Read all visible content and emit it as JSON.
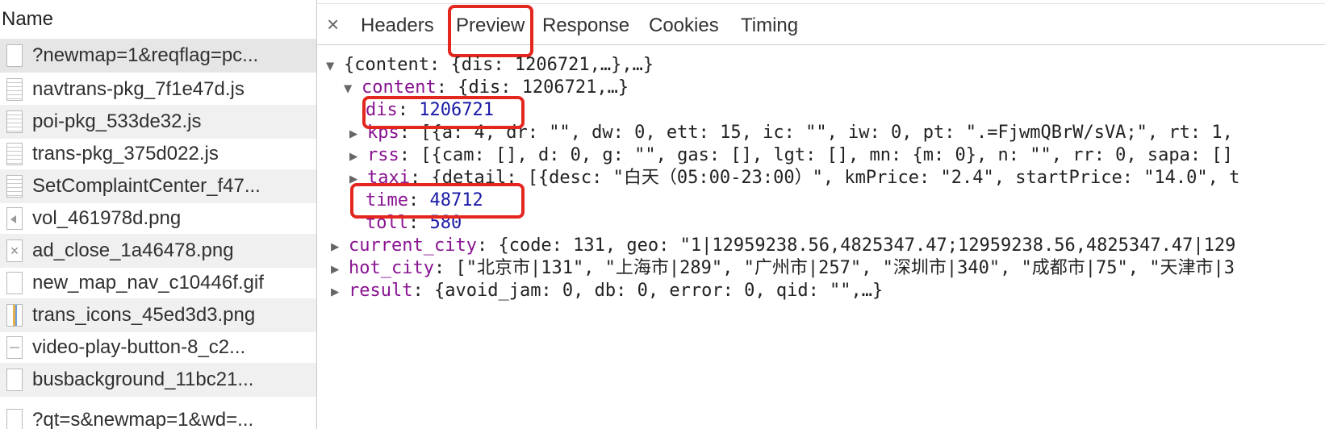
{
  "sidebar": {
    "header": "Name",
    "files": [
      {
        "name": "?newmap=1&reqflag=pc...",
        "icon": "document-icon"
      },
      {
        "name": "navtrans-pkg_7f1e47d.js",
        "icon": "script-file-icon"
      },
      {
        "name": "poi-pkg_533de32.js",
        "icon": "script-file-icon"
      },
      {
        "name": "trans-pkg_375d022.js",
        "icon": "script-file-icon"
      },
      {
        "name": "SetComplaintCenter_f47...",
        "icon": "script-file-icon"
      },
      {
        "name": "vol_461978d.png",
        "icon": "speaker-image-icon"
      },
      {
        "name": "ad_close_1a46478.png",
        "icon": "close-image-icon"
      },
      {
        "name": "new_map_nav_c10446f.gif",
        "icon": "document-icon"
      },
      {
        "name": "trans_icons_45ed3d3.png",
        "icon": "image-icon"
      },
      {
        "name": "video-play-button-8_c2...",
        "icon": "image-icon"
      },
      {
        "name": "busbackground_11bc21...",
        "icon": "document-icon"
      },
      {
        "name": "?qt=s&newmap=1&wd=...",
        "icon": "document-icon"
      }
    ]
  },
  "tabs": {
    "close": "×",
    "headers": "Headers",
    "preview": "Preview",
    "response": "Response",
    "cookies": "Cookies",
    "timing": "Timing",
    "active": "Preview"
  },
  "preview": {
    "root_summary": "{content: {dis: 1206721,…},…}",
    "content_key": "content",
    "content_summary": "{dis: 1206721,…}",
    "dis_key": "dis",
    "dis_value": "1206721",
    "kps_key": "kps",
    "kps_summary": "[{a: 4, dr: \"\", dw: 0, ett: 15, ic: \"\", iw: 0, pt: \".=FjwmQBrW/sVA;\", rt: 1,",
    "rss_key": "rss",
    "rss_summary": "[{cam: [], d: 0, g: \"\", gas: [], lgt: [], mn: {m: 0}, n: \"\", rr: 0, sapa: []",
    "taxi_key": "taxi",
    "taxi_summary": "{detail: [{desc: \"白天（05:00-23:00）\", kmPrice: \"2.4\", startPrice: \"14.0\", t",
    "time_key": "time",
    "time_value": "48712",
    "toll_key": "toll",
    "toll_value": "580",
    "current_city_key": "current_city",
    "current_city_summary": "{code: 131, geo: \"1|12959238.56,4825347.47;12959238.56,4825347.47|129",
    "hot_city_key": "hot_city",
    "hot_city_summary": "[\"北京市|131\", \"上海市|289\", \"广州市|257\", \"深圳市|340\", \"成都市|75\", \"天津市|3",
    "result_key": "result",
    "result_summary": "{avoid_jam: 0, db: 0, error: 0, qid: \"\",…}"
  },
  "colors": {
    "highlight": "#e3261e",
    "key": "#881391",
    "number": "#1a1aa6"
  }
}
